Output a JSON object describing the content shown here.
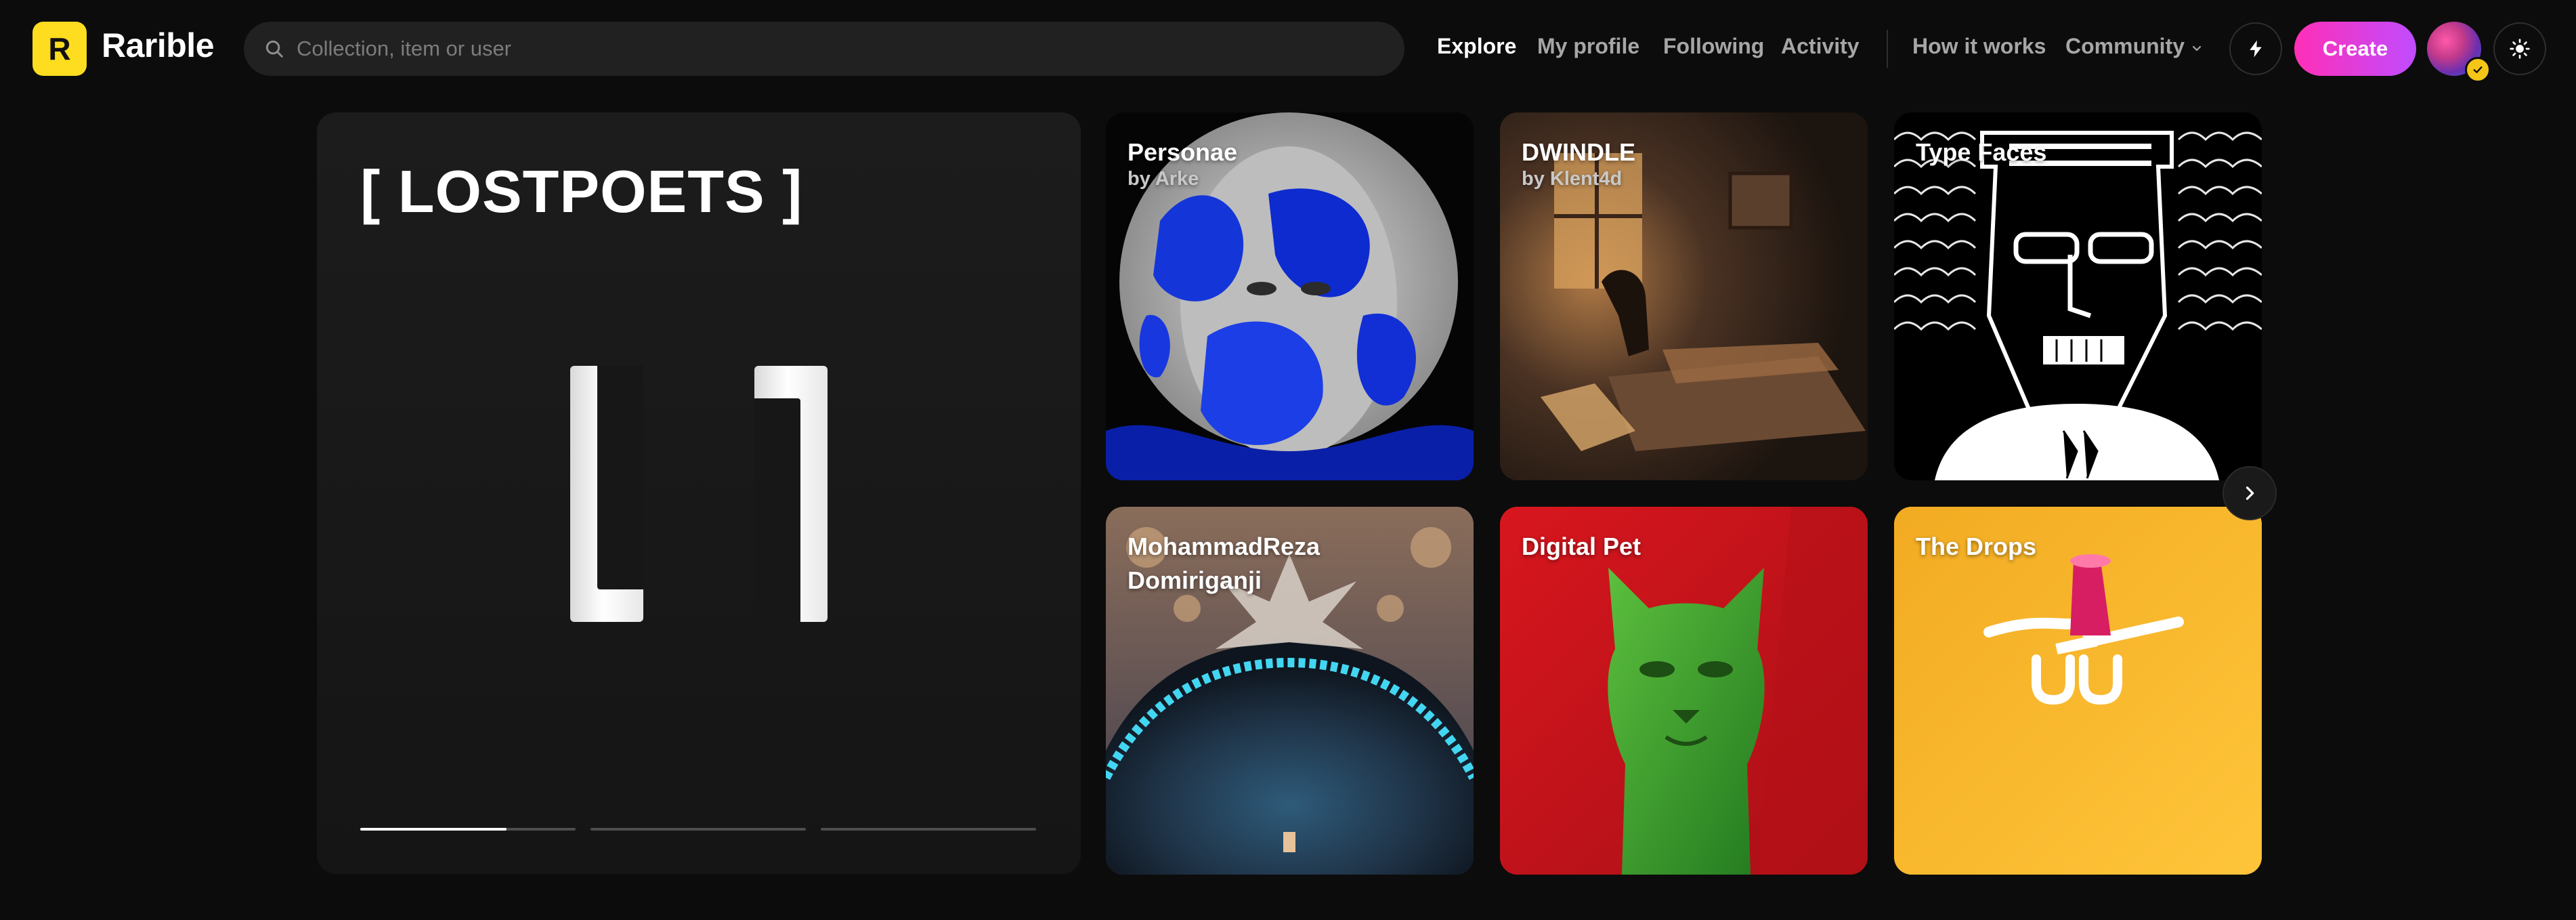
{
  "header": {
    "brand": "Rarible",
    "logo_letter": "R",
    "search_placeholder": "Collection, item or user",
    "nav": [
      {
        "label": "Explore",
        "active": true
      },
      {
        "label": "My profile",
        "active": false
      },
      {
        "label": "Following",
        "active": false
      },
      {
        "label": "Activity",
        "active": false
      },
      {
        "label": "How it works",
        "active": false
      },
      {
        "label": "Community",
        "active": false
      }
    ],
    "create_label": "Create",
    "icons": [
      "search-icon",
      "lightning-icon",
      "chevron-down-icon",
      "sun-icon",
      "verified-icon"
    ]
  },
  "hero": {
    "title": "[ LOSTPOETS ]",
    "slides_total": 3,
    "current_slide_progress": 0.68
  },
  "cards": [
    {
      "title": "Personae",
      "subtitle": "by Arke"
    },
    {
      "title": "DWINDLE",
      "subtitle": "by Klent4d"
    },
    {
      "title": "Type Faces",
      "subtitle": ""
    },
    {
      "title": "MohammadReza Domiriganji",
      "subtitle": ""
    },
    {
      "title": "Digital Pet",
      "subtitle": ""
    },
    {
      "title": "The Drops",
      "subtitle": ""
    }
  ],
  "colors": {
    "background": "#0c0c0c",
    "logo": "#fedc1f",
    "create_gradient_start": "#ff2fb6",
    "create_gradient_end": "#c04cff",
    "digital_pet_bg": "#c4141c",
    "the_drops_bg": "#f6b82a"
  }
}
